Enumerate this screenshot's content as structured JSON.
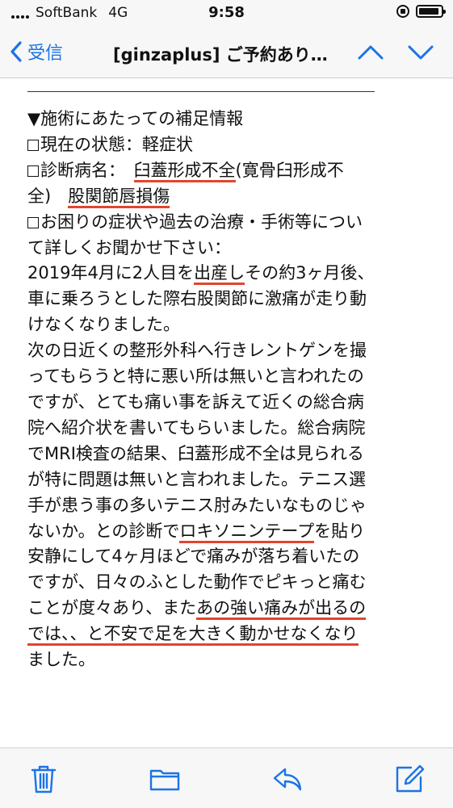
{
  "status": {
    "carrier": "SoftBank",
    "network": "4G",
    "time": "9:58"
  },
  "nav": {
    "back_label": "受信",
    "title": "[ginzaplus] ご予約あり…"
  },
  "email": {
    "heading": "▼施術にあたっての補足情報",
    "field1_label": "現在の状態：",
    "field1_value": "軽症状",
    "field2_label": "診断病名：　",
    "field2_value_ul": "臼蓋形成不全",
    "field2_value_rest": "(寛骨臼形成不",
    "field2_line2_a": "全)　",
    "field2_line2_ul": "股関節唇損傷",
    "field3_line1": "お困りの症状や過去の治療・手術等につい",
    "field3_line2": "て詳しくお聞かせ下さい：",
    "p1_l1_a": "2019年4月に2人目を",
    "p1_l1_ul": "出産し",
    "p1_l1_b": "その約3ヶ月後、",
    "p1_l2": "車に乗ろうとした際右股関節に激痛が走り動",
    "p1_l3": "けなくなりました。",
    "p2_l1": "次の日近くの整形外科へ行きレントゲンを撮",
    "p2_l2": "ってもらうと特に悪い所は無いと言われたの",
    "p2_l3": "ですが、とても痛い事を訴えて近くの総合病",
    "p2_l4": "院へ紹介状を書いてもらいました。総合病院",
    "p2_l5": "でMRI検査の結果、臼蓋形成不全は見られる",
    "p2_l6": "が特に問題は無いと言われました。テニス選",
    "p2_l7": "手が患う事の多いテニス肘みたいなものじゃ",
    "p2_l8_a": "ないか。との診断で",
    "p2_l8_ul": "ロキソニンテープ",
    "p2_l8_b": "を貼り",
    "p2_l9": "安静にして4ヶ月ほどで痛みが落ち着いたの",
    "p2_l10": "ですが、日々のふとした動作でピキっと痛む",
    "p2_l11_a": "ことが度々あり、また",
    "p2_l11_ul": "あの強い痛みが出るの",
    "p2_l12": "では、、と不安で足を大きく動かせなくなり",
    "p2_l13": "ました。"
  },
  "toolbar": {
    "icons": [
      "trash-icon",
      "folder-icon",
      "reply-icon",
      "compose-icon"
    ]
  },
  "colors": {
    "accent": "#1a73e8",
    "underline": "#e1452d"
  }
}
